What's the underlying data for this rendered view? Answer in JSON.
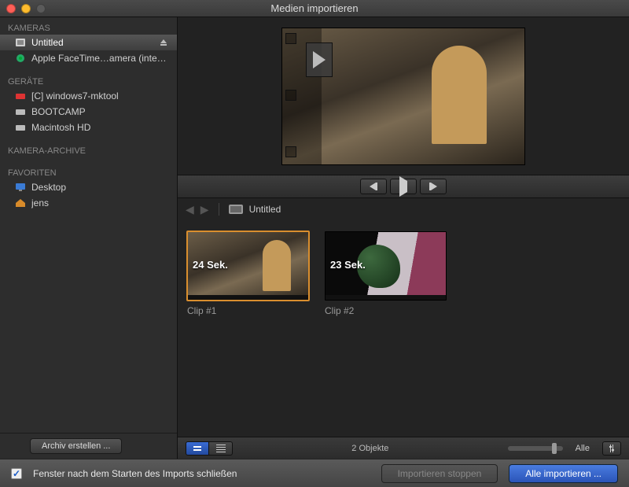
{
  "window": {
    "title": "Medien importieren"
  },
  "sidebar": {
    "sections": {
      "kameras": {
        "header": "Kameras",
        "items": [
          {
            "label": "Untitled",
            "icon": "sd-card",
            "selected": true,
            "ejectable": true
          },
          {
            "label": "Apple FaceTime…amera (integriert)",
            "icon": "camera"
          }
        ]
      },
      "geraete": {
        "header": "GERÄTE",
        "items": [
          {
            "label": "[C] windows7-mktool",
            "icon": "drive-red"
          },
          {
            "label": "BOOTCAMP",
            "icon": "drive"
          },
          {
            "label": "Macintosh HD",
            "icon": "drive"
          }
        ]
      },
      "archive": {
        "header": "Kamera-Archive"
      },
      "favoriten": {
        "header": "FAVORITEN",
        "items": [
          {
            "label": "Desktop",
            "icon": "desktop"
          },
          {
            "label": "jens",
            "icon": "home"
          }
        ]
      }
    },
    "archive_button": "Archiv erstellen ..."
  },
  "breadcrumb": {
    "title": "Untitled"
  },
  "clips": [
    {
      "duration": "24 Sek.",
      "label": "Clip #1",
      "selected": true
    },
    {
      "duration": "23 Sek.",
      "label": "Clip #2",
      "selected": false
    }
  ],
  "bottom": {
    "count": "2 Objekte",
    "zoom_label": "Alle"
  },
  "footer": {
    "checkbox_label": "Fenster nach dem Starten des Imports schließen",
    "stop_button": "Importieren stoppen",
    "import_button": "Alle importieren ..."
  }
}
